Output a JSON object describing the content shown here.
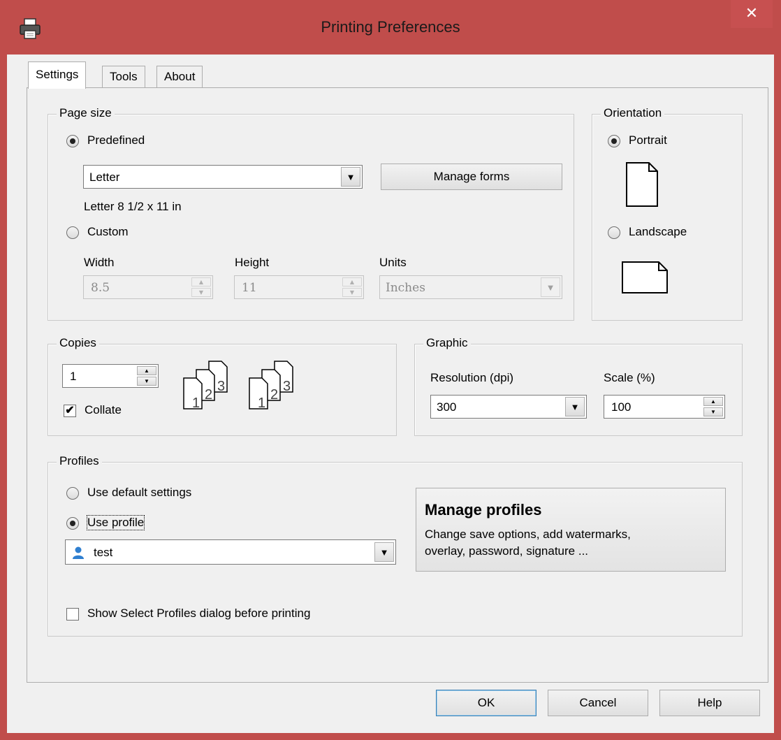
{
  "window": {
    "title": "Printing Preferences",
    "close_glyph": "✕",
    "icon": "printer-icon"
  },
  "tabs": [
    {
      "label": "Settings"
    },
    {
      "label": "Tools"
    },
    {
      "label": "About"
    }
  ],
  "page_size": {
    "group_label": "Page size",
    "predefined_label": "Predefined",
    "predefined_selected": true,
    "form_value": "Letter",
    "manage_forms_label": "Manage forms",
    "size_description": "Letter 8 1/2 x 11 in",
    "custom_label": "Custom",
    "custom_selected": false,
    "width_label": "Width",
    "width_value": "8.5",
    "height_label": "Height",
    "height_value": "11",
    "units_label": "Units",
    "units_value": "Inches"
  },
  "orientation": {
    "group_label": "Orientation",
    "portrait_label": "Portrait",
    "portrait_selected": true,
    "landscape_label": "Landscape",
    "landscape_selected": false
  },
  "copies": {
    "group_label": "Copies",
    "value": "1",
    "collate_label": "Collate",
    "collate_checked": true,
    "collate_page_numbers": [
      "1",
      "2",
      "3"
    ]
  },
  "graphic": {
    "group_label": "Graphic",
    "resolution_label": "Resolution (dpi)",
    "resolution_value": "300",
    "scale_label": "Scale (%)",
    "scale_value": "100"
  },
  "profiles": {
    "group_label": "Profiles",
    "use_default_label": "Use default settings",
    "use_default_selected": false,
    "use_profile_label": "Use profile",
    "use_profile_selected": true,
    "profile_value": "test",
    "profile_icon": "user-icon",
    "manage_title": "Manage profiles",
    "manage_description_line1": "Change save options, add watermarks,",
    "manage_description_line2": "overlay, password, signature ...",
    "show_dialog_label": "Show Select Profiles dialog before printing",
    "show_dialog_checked": false
  },
  "footer": {
    "ok_label": "OK",
    "cancel_label": "Cancel",
    "help_label": "Help"
  },
  "colors": {
    "titlebar": "#c04d4b",
    "dialog_bg": "#f0f0f0",
    "default_button_border": "#3c7fb1"
  }
}
